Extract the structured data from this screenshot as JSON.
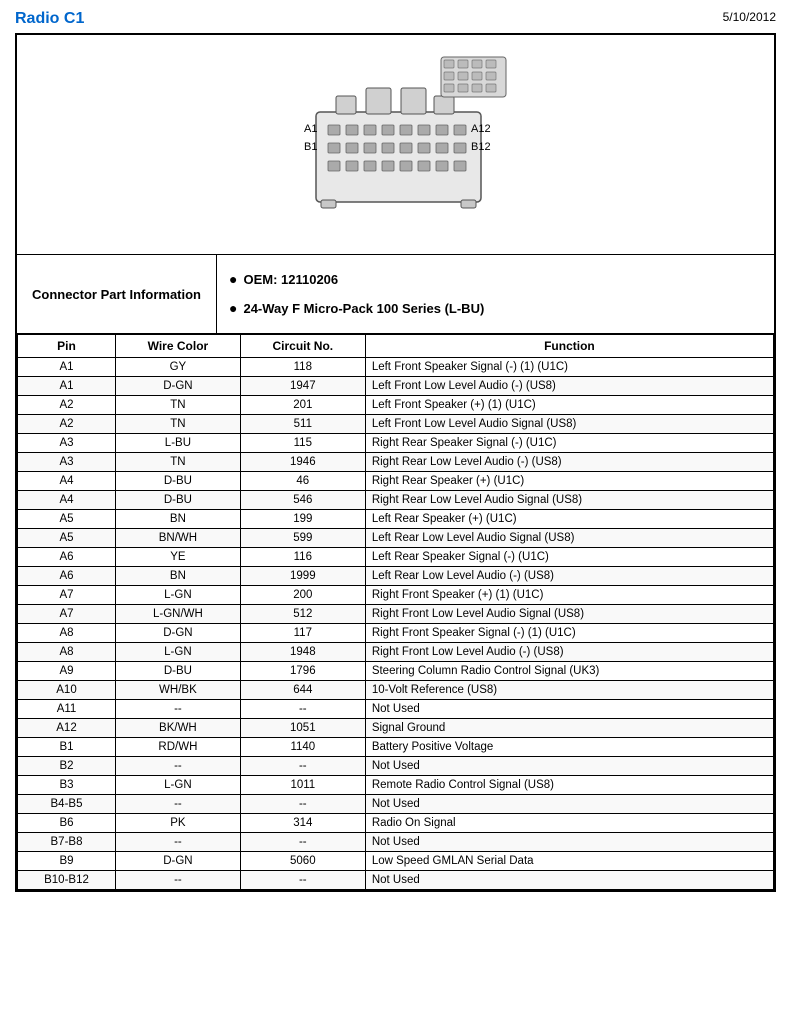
{
  "header": {
    "title": "Radio C1",
    "date": "5/10/2012"
  },
  "connector_info": {
    "label": "Connector Part Information",
    "oem": "OEM: 12110206",
    "series": "24-Way F Micro-Pack 100 Series (L-BU)"
  },
  "table": {
    "columns": [
      "Pin",
      "Wire Color",
      "Circuit No.",
      "Function"
    ],
    "rows": [
      [
        "A1",
        "GY",
        "118",
        "Left Front Speaker Signal (-) (1) (U1C)"
      ],
      [
        "A1",
        "D-GN",
        "1947",
        "Left Front Low Level Audio (-) (US8)"
      ],
      [
        "A2",
        "TN",
        "201",
        "Left Front Speaker (+) (1) (U1C)"
      ],
      [
        "A2",
        "TN",
        "511",
        "Left Front Low Level Audio Signal (US8)"
      ],
      [
        "A3",
        "L-BU",
        "115",
        "Right Rear Speaker Signal (-) (U1C)"
      ],
      [
        "A3",
        "TN",
        "1946",
        "Right Rear Low Level Audio (-) (US8)"
      ],
      [
        "A4",
        "D-BU",
        "46",
        "Right Rear Speaker (+) (U1C)"
      ],
      [
        "A4",
        "D-BU",
        "546",
        "Right Rear Low Level Audio Signal (US8)"
      ],
      [
        "A5",
        "BN",
        "199",
        "Left Rear Speaker (+) (U1C)"
      ],
      [
        "A5",
        "BN/WH",
        "599",
        "Left Rear Low Level Audio Signal (US8)"
      ],
      [
        "A6",
        "YE",
        "116",
        "Left Rear Speaker Signal (-) (U1C)"
      ],
      [
        "A6",
        "BN",
        "1999",
        "Left Rear Low Level Audio (-) (US8)"
      ],
      [
        "A7",
        "L-GN",
        "200",
        "Right Front Speaker (+) (1) (U1C)"
      ],
      [
        "A7",
        "L-GN/WH",
        "512",
        "Right Front Low Level Audio Signal (US8)"
      ],
      [
        "A8",
        "D-GN",
        "117",
        "Right Front Speaker Signal (-) (1) (U1C)"
      ],
      [
        "A8",
        "L-GN",
        "1948",
        "Right Front Low Level Audio (-) (US8)"
      ],
      [
        "A9",
        "D-BU",
        "1796",
        "Steering Column Radio Control Signal (UK3)"
      ],
      [
        "A10",
        "WH/BK",
        "644",
        "10-Volt Reference (US8)"
      ],
      [
        "A11",
        "--",
        "--",
        "Not Used"
      ],
      [
        "A12",
        "BK/WH",
        "1051",
        "Signal Ground"
      ],
      [
        "B1",
        "RD/WH",
        "1140",
        "Battery Positive Voltage"
      ],
      [
        "B2",
        "--",
        "--",
        "Not Used"
      ],
      [
        "B3",
        "L-GN",
        "1011",
        "Remote Radio Control Signal (US8)"
      ],
      [
        "B4-B5",
        "--",
        "--",
        "Not Used"
      ],
      [
        "B6",
        "PK",
        "314",
        "Radio On Signal"
      ],
      [
        "B7-B8",
        "--",
        "--",
        "Not Used"
      ],
      [
        "B9",
        "D-GN",
        "5060",
        "Low Speed GMLAN Serial Data"
      ],
      [
        "B10-B12",
        "--",
        "--",
        "Not Used"
      ]
    ]
  }
}
